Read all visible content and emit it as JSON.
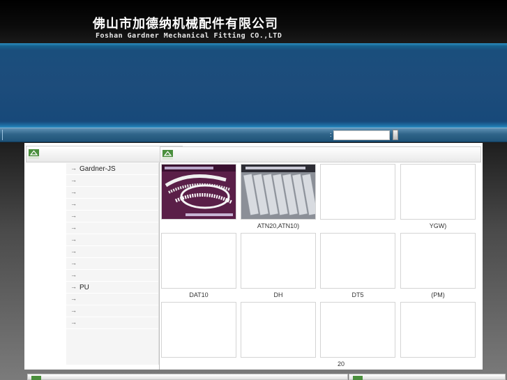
{
  "header": {
    "company_name_cn": "佛山市加德纳机械配件有限公司",
    "company_name_en": "Foshan Gardner Mechanical Fitting CO.,LTD"
  },
  "colors": {
    "banner": "#1d4c7b",
    "navbar": "#2f6489",
    "badge_green": "#4a8f3d"
  },
  "search": {
    "colon": ":",
    "value": "",
    "placeholder": ""
  },
  "left_panel": {
    "badge_icon": "house-badge-icon",
    "categories": [
      {
        "label": "Gardner-JS"
      },
      {
        "label": ""
      },
      {
        "label": ""
      },
      {
        "label": ""
      },
      {
        "label": ""
      },
      {
        "label": ""
      },
      {
        "label": ""
      },
      {
        "label": ""
      },
      {
        "label": ""
      },
      {
        "label": ""
      },
      {
        "label": "PU"
      },
      {
        "label": ""
      },
      {
        "label": ""
      },
      {
        "label": ""
      }
    ]
  },
  "right_panel": {
    "badge_icon": "house-badge-icon",
    "products": [
      {
        "caption": "",
        "image": "white-timing-belt-photo"
      },
      {
        "caption": "ATN20,ATN10)",
        "image": "cleated-belt-segments-photo"
      },
      {
        "caption": ""
      },
      {
        "caption": "YGW)"
      },
      {
        "caption": "DAT10"
      },
      {
        "caption": "DH"
      },
      {
        "caption": "DT5"
      },
      {
        "caption": "(PM)"
      },
      {
        "caption": ""
      },
      {
        "caption": ""
      },
      {
        "caption": ""
      },
      {
        "caption": ""
      }
    ],
    "page_number": "20"
  }
}
